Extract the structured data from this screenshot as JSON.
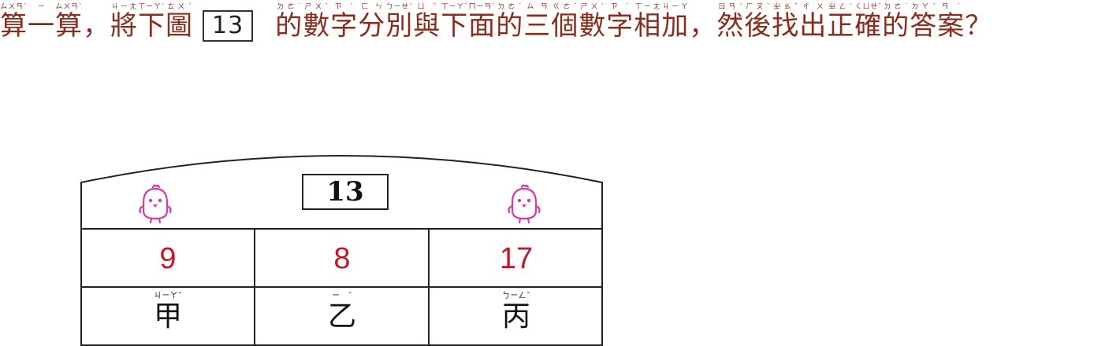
{
  "question": {
    "part1": "算一算，將下圖",
    "box_number": "13",
    "part2": "的數字分別與下面的三個數字相加，然後找出正確的答案？",
    "zhuyin": {
      "suan": "ㄙㄨㄢˋ",
      "yi": "ㄧ",
      "jiang": "ㄐㄧㄤ",
      "xia": "ㄒㄧㄚˋ",
      "tu": "ㄊㄨˊ",
      "de": "ㄉㄜ˙",
      "shu": "ㄕㄨˋ",
      "zi": "ㄗˋ",
      "fen": "ㄈㄣ",
      "bie": "ㄅㄧㄝˊ",
      "yu": "ㄩˇ",
      "mian": "ㄇㄧㄢˋ",
      "san": "ㄙㄢ",
      "ge": "ㄍㄜ˙",
      "xiang": "ㄒㄧㄤ",
      "jia": "ㄐㄧㄚ",
      "ran": "ㄖㄢˊ",
      "hou": "ㄏㄡˋ",
      "zhao": "ㄓㄠˇ",
      "chu": "ㄔㄨ",
      "zheng": "ㄓㄥˋ",
      "que": "ㄑㄩㄝˋ",
      "da": "ㄉㄚˊ",
      "an": "ㄢˋ"
    }
  },
  "figure": {
    "top_number": "13",
    "icons": [
      "chick-icon",
      "chick-icon"
    ],
    "colors": {
      "question_text": "#8a2c1c",
      "values": "#c4162a",
      "chick": "#d63ba6"
    },
    "cells": [
      {
        "value": "9",
        "label": "甲",
        "zhuyin": "ㄐㄧㄚˇ"
      },
      {
        "value": "8",
        "label": "乙",
        "zhuyin": "ㄧˇ"
      },
      {
        "value": "17",
        "label": "丙",
        "zhuyin": "ㄅㄧㄥˇ"
      }
    ]
  }
}
